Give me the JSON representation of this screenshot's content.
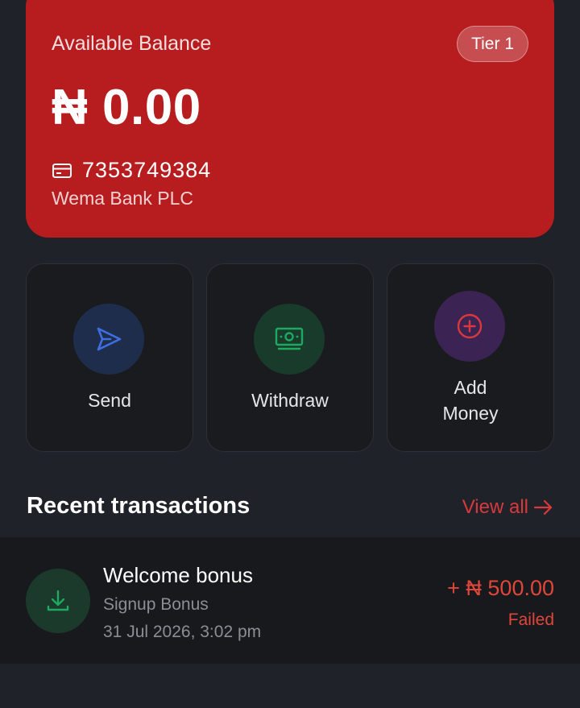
{
  "balance_card": {
    "label": "Available Balance",
    "tier": "Tier 1",
    "amount": "₦ 0.00",
    "account_number": "7353749384",
    "bank_name": "Wema Bank PLC",
    "background_color": "#b71c1f"
  },
  "actions": [
    {
      "label": "Send",
      "icon": "send-icon",
      "color": "#3d6fe0"
    },
    {
      "label": "Withdraw",
      "icon": "cash-icon",
      "color": "#1fa862"
    },
    {
      "label_line1": "Add",
      "label_line2": "Money",
      "icon": "plus-circle-icon",
      "color": "#d9393c"
    }
  ],
  "recent": {
    "title": "Recent transactions",
    "view_all": "View all",
    "transactions": [
      {
        "title": "Welcome bonus",
        "category": "Signup Bonus",
        "date": "31 Jul 2026, 3:02 pm",
        "amount": "+ ₦ 500.00",
        "status": "Failed",
        "icon": "download-icon"
      }
    ]
  }
}
